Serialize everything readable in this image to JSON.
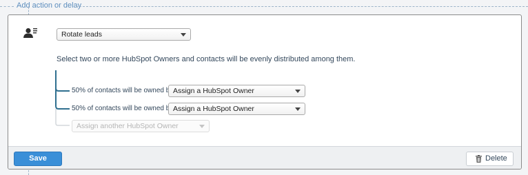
{
  "header": {
    "add_action_label": "Add action or delay"
  },
  "action": {
    "icon": "lead-rotation-icon",
    "type_select": "Rotate leads",
    "description": "Select two or more HubSpot Owners and contacts will be evenly distributed among them.",
    "rows": [
      {
        "label": "50% of contacts will be owned by",
        "owner_select": "Assign a HubSpot Owner"
      },
      {
        "label": "50% of contacts will be owned by",
        "owner_select": "Assign a HubSpot Owner"
      }
    ],
    "add_owner_placeholder": "Assign another HubSpot Owner"
  },
  "footer": {
    "save_label": "Save",
    "delete_label": "Delete",
    "delete_icon": "trash-icon"
  },
  "colors": {
    "accent": "#3a8fd8",
    "branch_line": "#2f6f8f",
    "branch_line_disabled": "#d3d7db"
  }
}
